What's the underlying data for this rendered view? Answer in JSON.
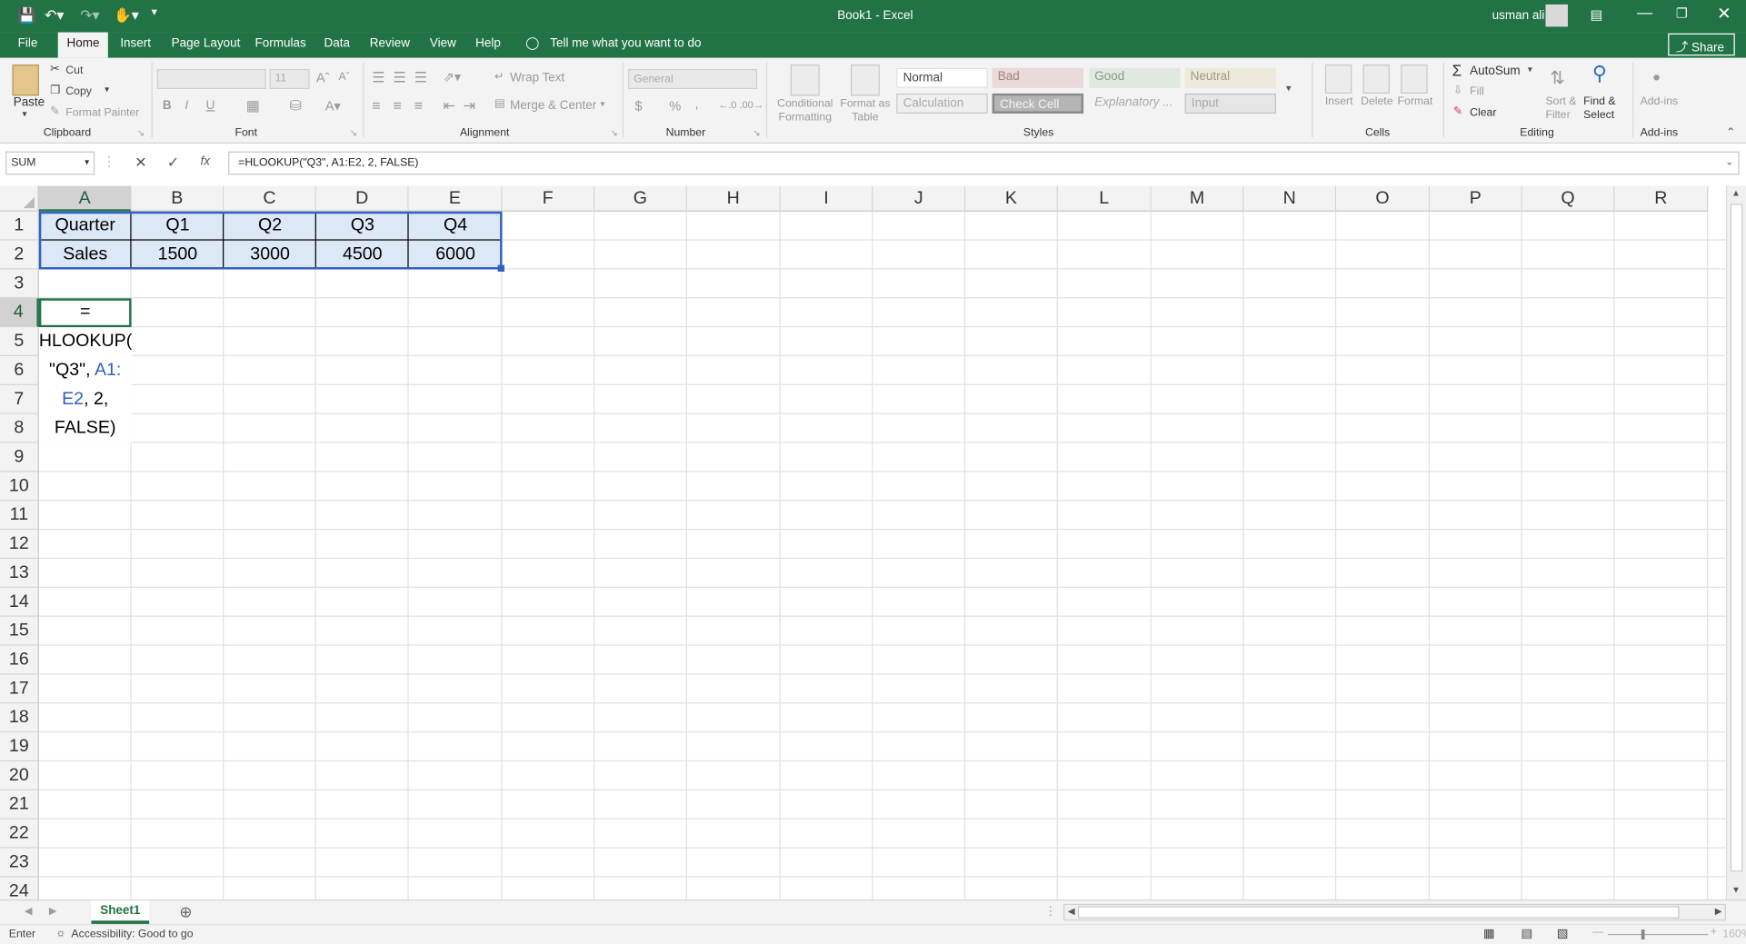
{
  "titlebar": {
    "title": "Book1  -  Excel",
    "user": "usman ali",
    "share": "Share"
  },
  "tabs": [
    "File",
    "Home",
    "Insert",
    "Page Layout",
    "Formulas",
    "Data",
    "Review",
    "View",
    "Help"
  ],
  "tell_me": "Tell me what you want to do",
  "ribbon": {
    "clipboard": {
      "paste": "Paste",
      "cut": "Cut",
      "copy": "Copy",
      "format_painter": "Format Painter",
      "label": "Clipboard"
    },
    "font": {
      "size": "11",
      "bold": "B",
      "italic": "I",
      "underline": "U",
      "label": "Font"
    },
    "alignment": {
      "wrap": "Wrap Text",
      "merge": "Merge & Center",
      "label": "Alignment"
    },
    "number": {
      "format": "General",
      "currency": "$",
      "percent": "%",
      "comma": ",",
      "label": "Number"
    },
    "styles": {
      "conditional": "Conditional Formatting",
      "format_table": "Format as Table",
      "normal": "Normal",
      "bad": "Bad",
      "good": "Good",
      "neutral": "Neutral",
      "calculation": "Calculation",
      "check_cell": "Check Cell",
      "explanatory": "Explanatory ...",
      "input": "Input",
      "label": "Styles"
    },
    "cells": {
      "insert": "Insert",
      "delete": "Delete",
      "format": "Format",
      "label": "Cells"
    },
    "editing": {
      "autosum": "AutoSum",
      "fill": "Fill",
      "clear": "Clear",
      "sort": "Sort & Filter",
      "find": "Find & Select",
      "label": "Editing"
    },
    "addins": {
      "addins": "Add-ins",
      "label": "Add-ins"
    }
  },
  "formula_bar": {
    "name_box": "SUM",
    "fx": "fx",
    "formula": "=HLOOKUP(\"Q3\", A1:E2, 2, FALSE)"
  },
  "grid": {
    "columns": [
      "A",
      "B",
      "C",
      "D",
      "E",
      "F",
      "G",
      "H",
      "I",
      "J",
      "K",
      "L",
      "M",
      "N",
      "O",
      "P",
      "Q",
      "R"
    ],
    "rows": [
      "1",
      "2",
      "3",
      "4",
      "5",
      "6",
      "7",
      "8",
      "9",
      "10",
      "11",
      "12",
      "13",
      "14",
      "15",
      "16",
      "17",
      "18",
      "19",
      "20",
      "21",
      "22",
      "23",
      "24"
    ],
    "row1": [
      "Quarter",
      "Q1",
      "Q2",
      "Q3",
      "Q4"
    ],
    "row2": [
      "Sales",
      "1500",
      "3000",
      "4500",
      "6000"
    ],
    "editing_cell": {
      "line1": "=",
      "line2": "HLOOKUP(",
      "line3a": "\"Q3\", ",
      "line3b": "A1:",
      "line4a": "E2",
      "line4b": ", 2,",
      "line5": "FALSE)"
    }
  },
  "sheets": [
    "Sheet1"
  ],
  "status": {
    "mode": "Enter",
    "accessibility": "Accessibility: Good to go",
    "zoom": "160%"
  },
  "colors": {
    "excel_green": "#217346",
    "ref_blue": "#3060c0",
    "ref_fill": "#dde8f6"
  }
}
